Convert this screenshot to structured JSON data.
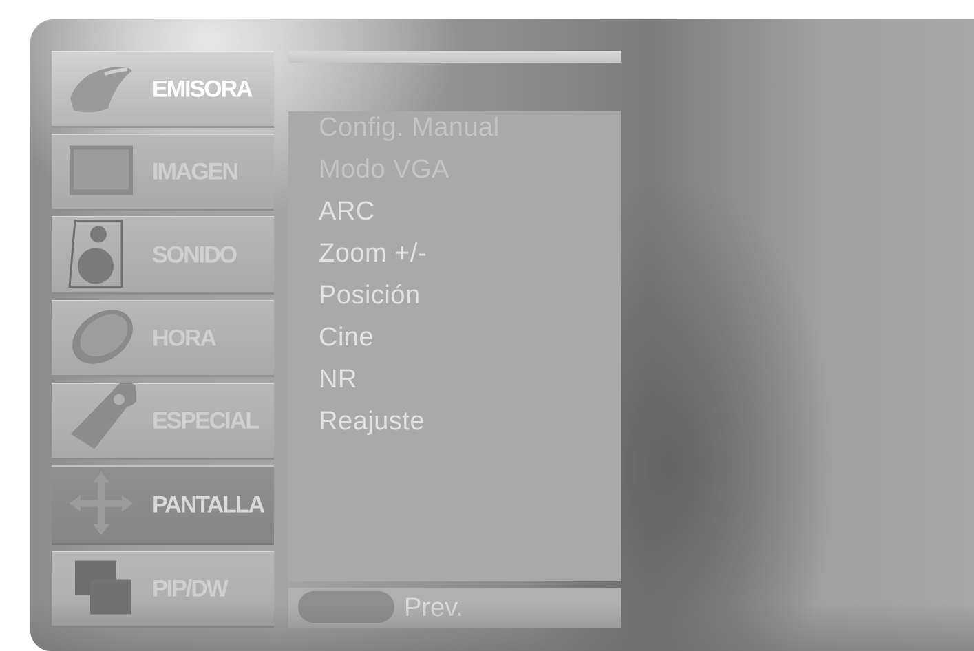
{
  "menu": {
    "items": [
      {
        "label": "EMISORA",
        "icon": "satellite-icon"
      },
      {
        "label": "IMAGEN",
        "icon": "picture-icon"
      },
      {
        "label": "SONIDO",
        "icon": "speaker-icon"
      },
      {
        "label": "HORA",
        "icon": "clock-icon"
      },
      {
        "label": "ESPECIAL",
        "icon": "tag-icon"
      },
      {
        "label": "PANTALLA",
        "icon": "move-arrows-icon"
      },
      {
        "label": "PIP/DW",
        "icon": "pip-icon"
      }
    ],
    "active_index": 5
  },
  "submenu": {
    "items": [
      "Config. Manual",
      "Modo VGA",
      "ARC",
      "Zoom +/-",
      "Posición",
      "Cine",
      "NR",
      "Reajuste"
    ],
    "disabled": [
      "Config. Manual",
      "Modo VGA"
    ]
  },
  "footer": {
    "prev_label": "Prev."
  },
  "colors": {
    "panel": "#a9a9a9",
    "active_item": "#8a8a8a",
    "text": "#e2e2e2"
  }
}
